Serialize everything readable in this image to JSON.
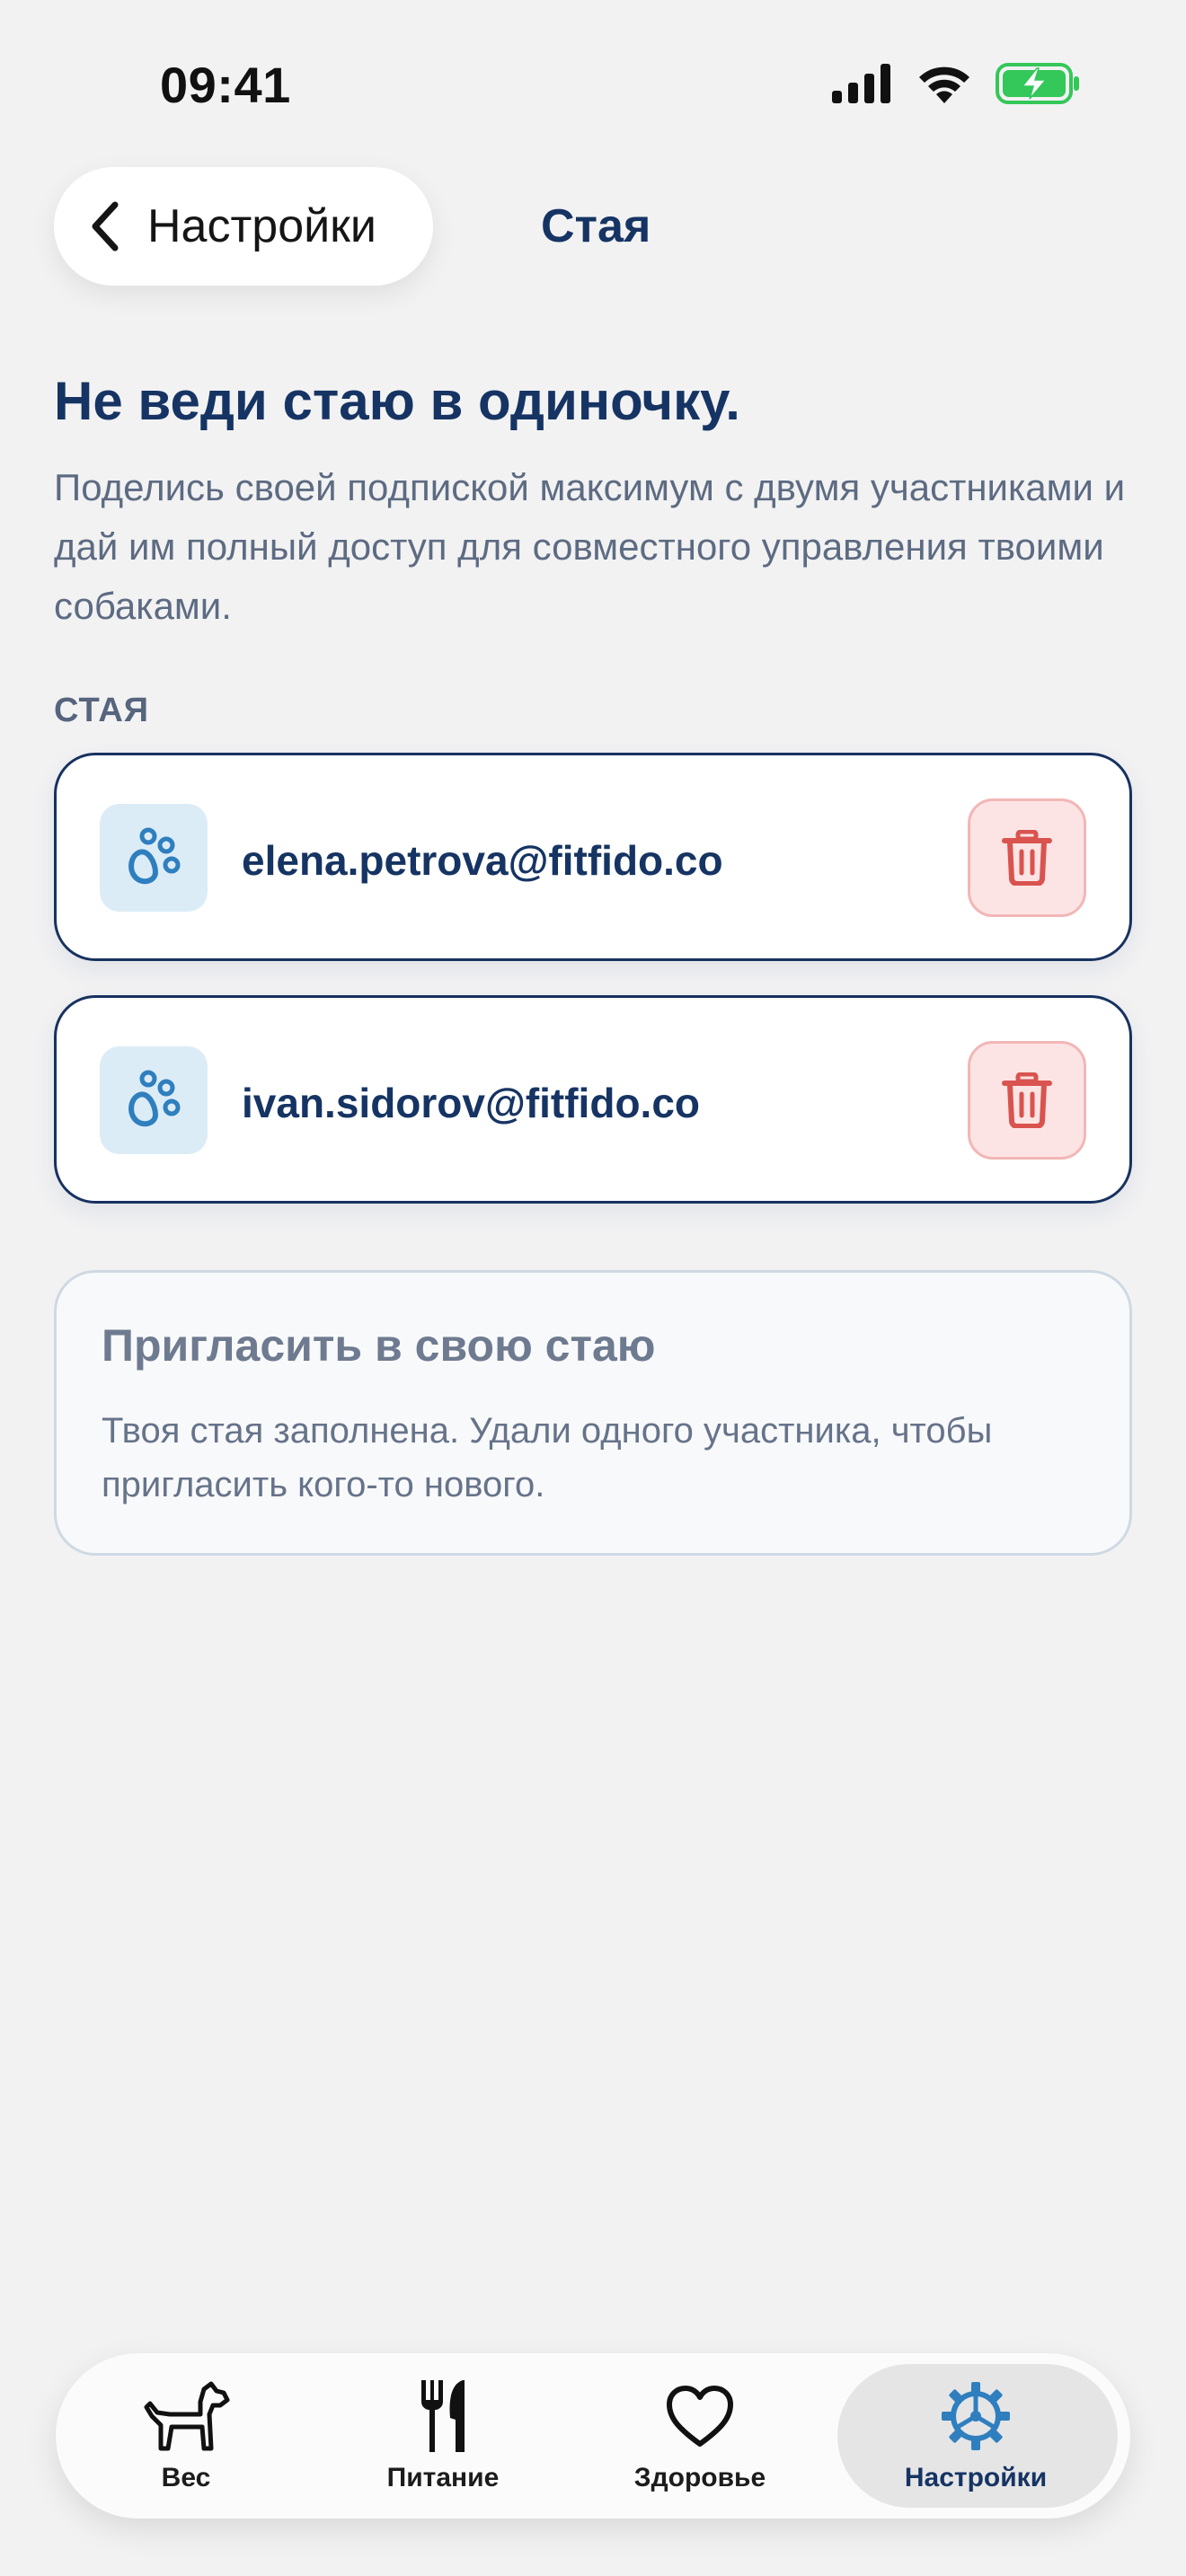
{
  "status_bar": {
    "time": "09:41"
  },
  "nav": {
    "back_label": "Настройки",
    "title": "Стая"
  },
  "intro": {
    "headline": "Не веди стаю в одиночку.",
    "text": "Поделись своей подпиской максимум с двумя участниками и дай им полный доступ для совместного управления твоими собаками."
  },
  "section_label": "СТАЯ",
  "members": [
    {
      "email": "elena.petrova@fitfido.co",
      "icon": "paw-icon"
    },
    {
      "email": "ivan.sidorov@fitfido.co",
      "icon": "paw-icon"
    }
  ],
  "invite": {
    "title": "Пригласить в свою стаю",
    "text": "Твоя стая заполнена. Удали одного участника, чтобы пригласить кого-то нового."
  },
  "tabbar": {
    "tabs": [
      {
        "label": "Вес",
        "icon": "dog-icon"
      },
      {
        "label": "Питание",
        "icon": "fork-knife-icon"
      },
      {
        "label": "Здоровье",
        "icon": "heart-icon"
      },
      {
        "label": "Настройки",
        "icon": "settings-gear-icon",
        "active": true
      }
    ]
  },
  "colors": {
    "accent_navy": "#163463",
    "icon_blue": "#2f7fbf",
    "delete_red": "#d9534f",
    "battery_green": "#34c759"
  }
}
